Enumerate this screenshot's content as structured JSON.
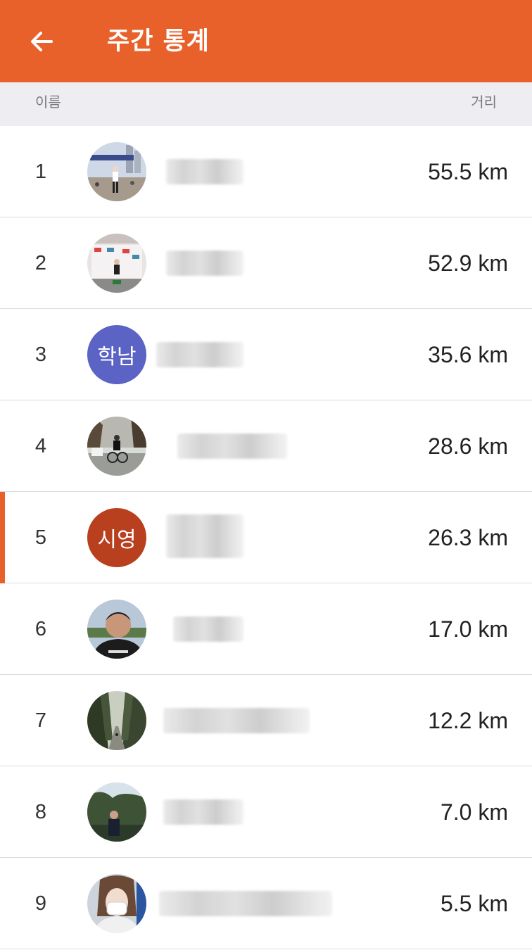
{
  "header": {
    "title": "주간 통계",
    "back_icon": "arrow-left-icon",
    "bg_color": "#e8612b"
  },
  "columns": {
    "name": "이름",
    "distance": "거리"
  },
  "rows": [
    {
      "rank": "1",
      "distance": "55.5 km",
      "avatar": "photo"
    },
    {
      "rank": "2",
      "distance": "52.9 km",
      "avatar": "photo"
    },
    {
      "rank": "3",
      "distance": "35.6 km",
      "avatar": "initials",
      "initials": "학남",
      "avatar_color": "#5b63c4"
    },
    {
      "rank": "4",
      "distance": "28.6 km",
      "avatar": "photo"
    },
    {
      "rank": "5",
      "distance": "26.3 km",
      "avatar": "initials",
      "initials": "시영",
      "avatar_color": "#b8401f",
      "current_user": true
    },
    {
      "rank": "6",
      "distance": "17.0 km",
      "avatar": "photo"
    },
    {
      "rank": "7",
      "distance": "12.2 km",
      "avatar": "photo"
    },
    {
      "rank": "8",
      "distance": "7.0 km",
      "avatar": "photo"
    },
    {
      "rank": "9",
      "distance": "5.5 km",
      "avatar": "photo"
    }
  ]
}
